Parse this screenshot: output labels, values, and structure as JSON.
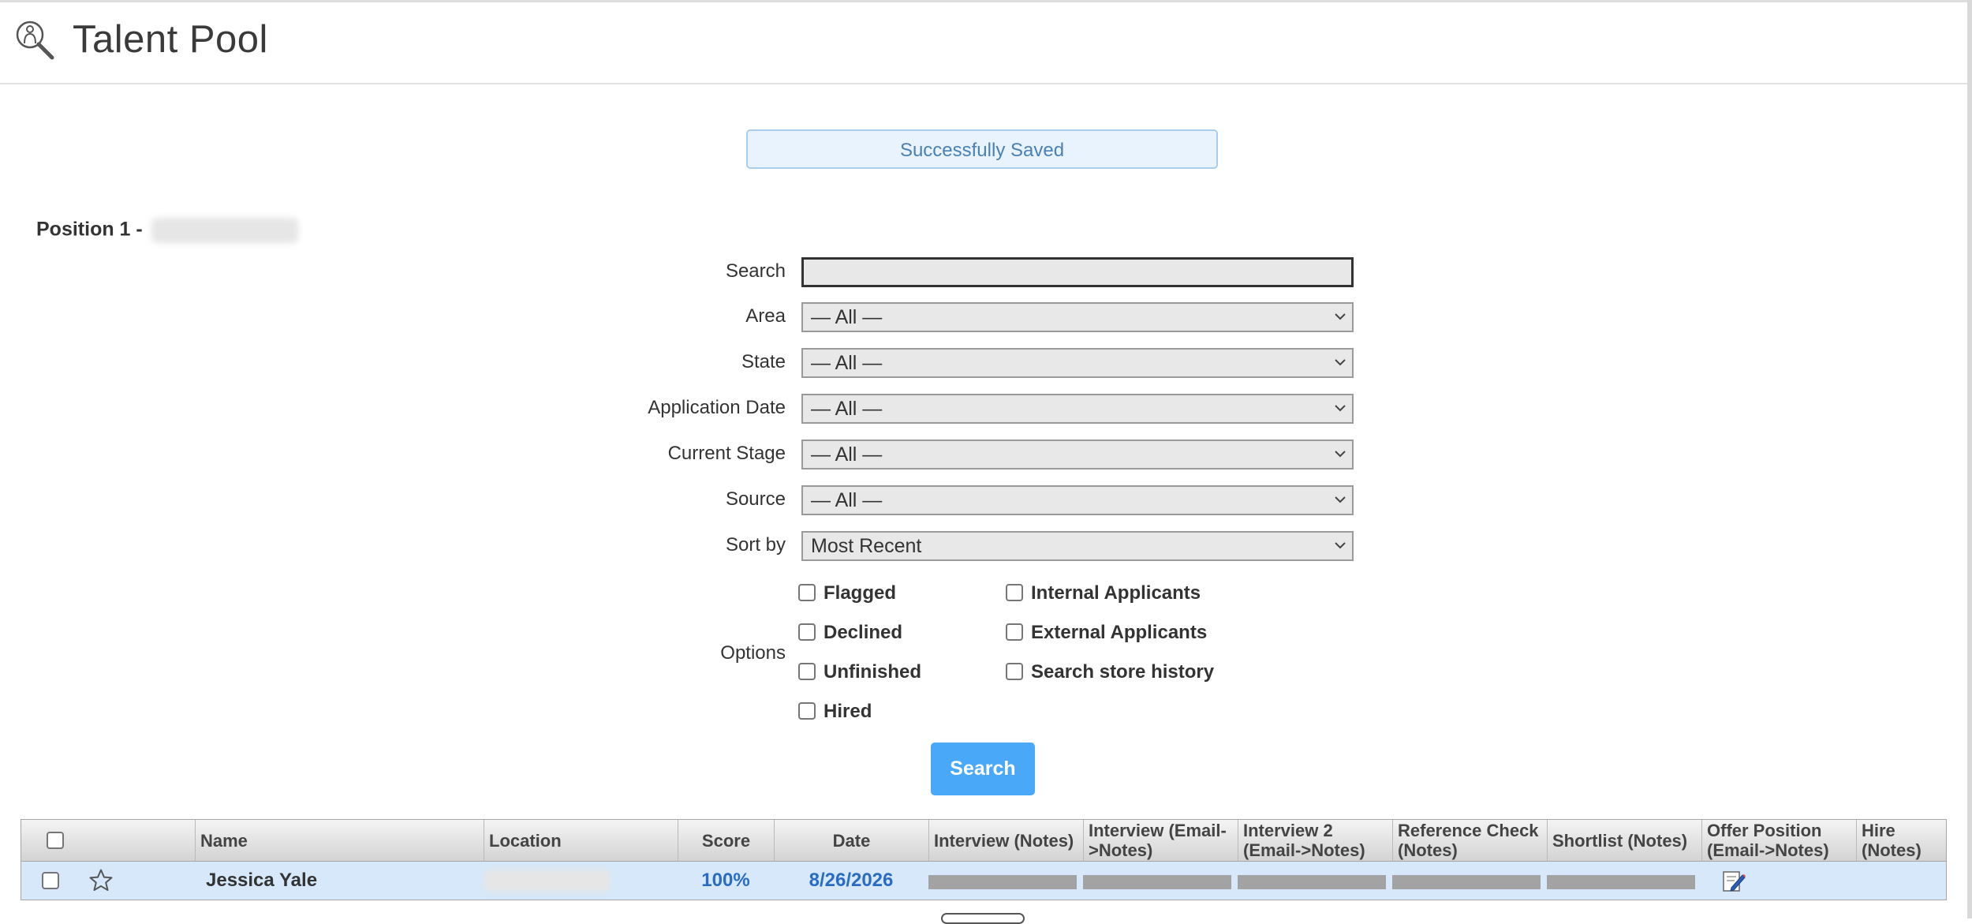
{
  "header": {
    "title": "Talent Pool",
    "logo_icon": "talent-search-icon"
  },
  "banner": {
    "message": "Successfully Saved"
  },
  "position": {
    "label": "Position 1 -"
  },
  "filters": {
    "search": {
      "label": "Search",
      "value": ""
    },
    "area": {
      "label": "Area",
      "value": "— All —"
    },
    "state": {
      "label": "State",
      "value": "— All —"
    },
    "application_date": {
      "label": "Application Date",
      "value": "— All —"
    },
    "current_stage": {
      "label": "Current Stage",
      "value": "— All —"
    },
    "source": {
      "label": "Source",
      "value": "— All —"
    },
    "sort_by": {
      "label": "Sort by",
      "value": "Most Recent"
    }
  },
  "options": {
    "label": "Options",
    "flagged": "Flagged",
    "declined": "Declined",
    "unfinished": "Unfinished",
    "hired": "Hired",
    "internal": "Internal Applicants",
    "external": "External Applicants",
    "store_history": "Search store history"
  },
  "search_button": "Search",
  "table": {
    "columns": {
      "name": "Name",
      "location": "Location",
      "score": "Score",
      "date": "Date",
      "interview": "Interview (Notes)",
      "interview_email": "Interview (Email->Notes)",
      "interview2": "Interview 2 (Email->Notes)",
      "reference": "Reference Check (Notes)",
      "shortlist": "Shortlist (Notes)",
      "offer": "Offer Position (Email->Notes)",
      "hire": "Hire (Notes)"
    },
    "rows": [
      {
        "name": "Jessica Yale",
        "score": "100%",
        "date": "8/26/2026"
      }
    ]
  }
}
